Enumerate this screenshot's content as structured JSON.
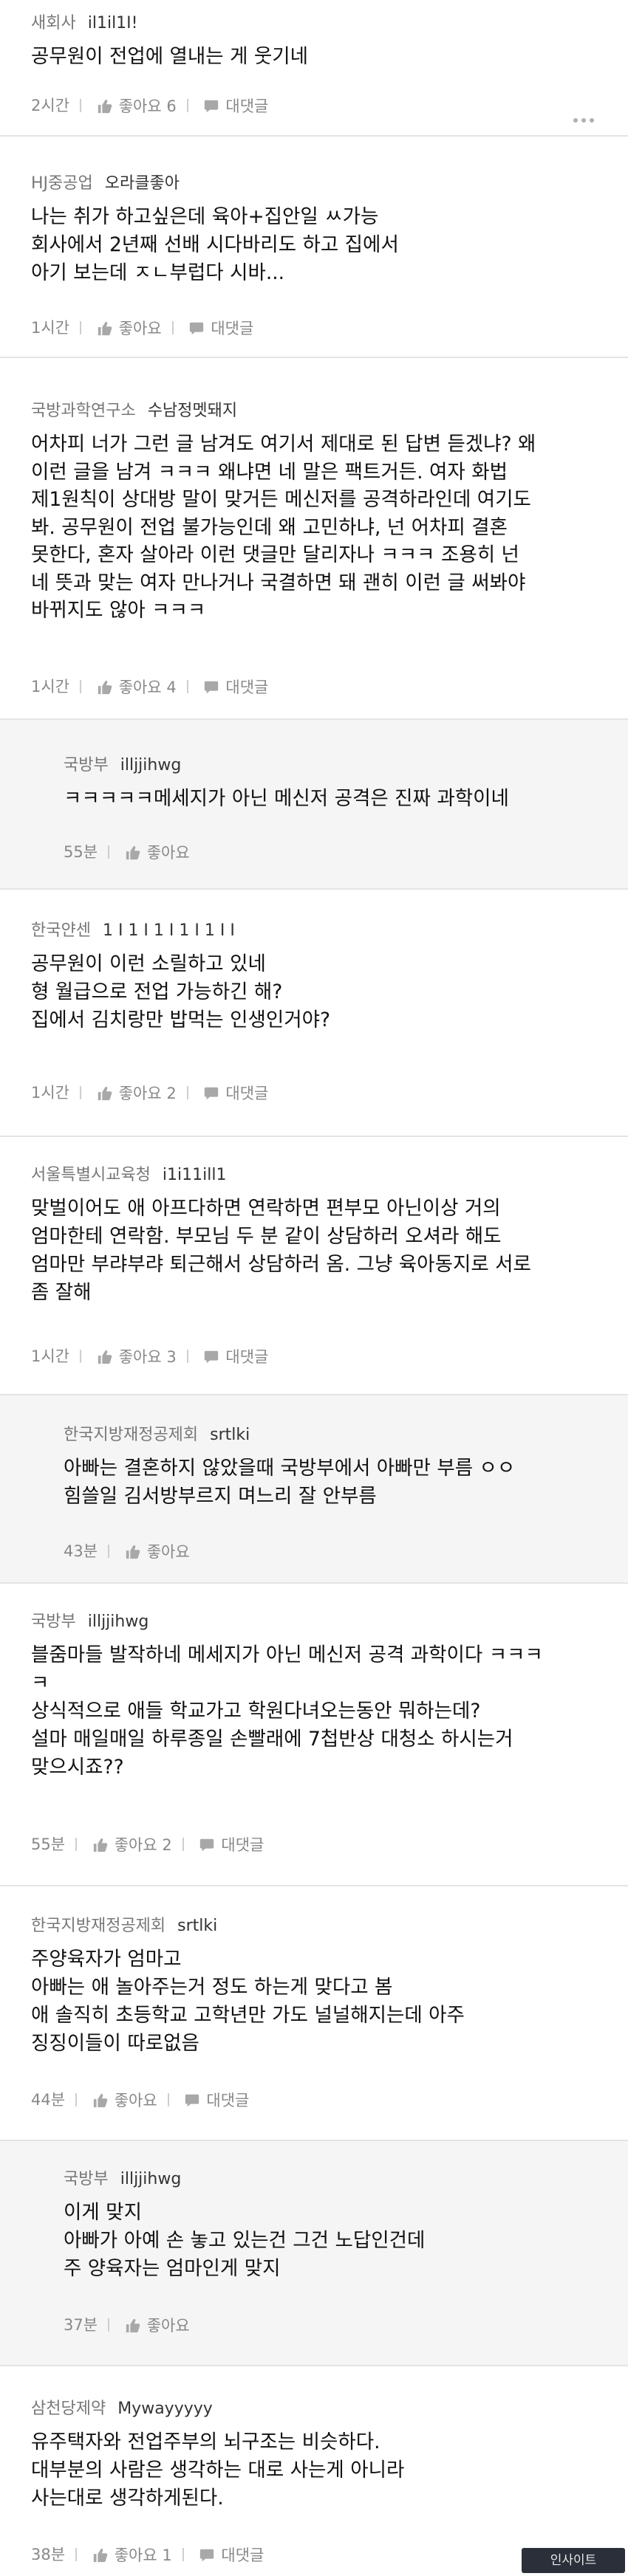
{
  "comments": [
    {
      "company": "새회사",
      "nick": "il1il1I!",
      "body": "공무원이 전업에 열내는 게 웃기네",
      "time": "2시간",
      "likes": "좋아요 6",
      "reply": "대댓글"
    },
    {
      "company": "HJ중공업",
      "nick": "오라클좋아",
      "body": "나는 취가 하고싶은데 육아+집안일 ㅆ가능\n회사에서 2년째 선배 시다바리도 하고 집에서\n아기 보는데 ㅈㄴ부럽다 시바...",
      "time": "1시간",
      "likes": "좋아요",
      "reply": "대댓글"
    },
    {
      "company": "국방과학연구소",
      "nick": "수남정멧돼지",
      "body": "어차피 너가 그런 글 남겨도 여기서 제대로 된 답변 듣겠냐? 왜\n이런 글을 남겨 ㅋㅋㅋ  왜냐면 네 말은 팩트거든. 여자 화법\n제1원칙이 상대방 말이 맞거든 메신저를 공격하라인데 여기도\n봐. 공무원이 전업 불가능인데 왜 고민하냐, 넌 어차피 결혼\n못한다, 혼자 살아라 이런 댓글만 달리자나 ㅋㅋㅋ 조용히 넌\n네 뜻과 맞는 여자 만나거나 국결하면 돼 괜히 이런 글 써봐야\n바뀌지도 않아 ㅋㅋㅋ",
      "time": "1시간",
      "likes": "좋아요 4",
      "reply": "대댓글"
    },
    {
      "company": "국방부",
      "nick": "illjjihwg",
      "body": "ㅋㅋㅋㅋㅋ메세지가 아닌 메신저 공격은 진짜 과학이네",
      "time": "55분",
      "likes": "좋아요",
      "reply": ""
    },
    {
      "company": "한국얀센",
      "nick": "1 I 1 I 1 I 1 I 1 I I",
      "body": "공무원이 이런 소릴하고 있네\n형 월급으로 전업 가능하긴 해?\n집에서 김치랑만 밥먹는 인생인거야?",
      "time": "1시간",
      "likes": "좋아요 2",
      "reply": "대댓글"
    },
    {
      "company": "서울특별시교육청",
      "nick": "i1i11ill1",
      "body": "맞벌이어도 애 아프다하면 연락하면 편부모 아닌이상 거의\n엄마한테 연락함. 부모님 두 분 같이 상담하러 오셔라 해도\n엄마만 부랴부랴 퇴근해서 상담하러 옴. 그냥 육아동지로 서로\n좀 잘해",
      "time": "1시간",
      "likes": "좋아요 3",
      "reply": "대댓글"
    },
    {
      "company": "한국지방재정공제회",
      "nick": "srtlki",
      "body": "아빠는 결혼하지 않았을때 국방부에서 아빠만 부름 ㅇㅇ\n힘쓸일 김서방부르지 며느리 잘 안부름",
      "time": "43분",
      "likes": "좋아요",
      "reply": ""
    },
    {
      "company": "국방부",
      "nick": "illjjihwg",
      "body": "블줌마들 발작하네 메세지가 아닌 메신저 공격 과학이다 ㅋㅋㅋ\nㅋ\n상식적으로 애들 학교가고 학원다녀오는동안 뭐하는데?\n설마 매일매일 하루종일 손빨래에 7첩반상 대청소 하시는거\n맞으시죠??",
      "time": "55분",
      "likes": "좋아요 2",
      "reply": "대댓글"
    },
    {
      "company": "한국지방재정공제회",
      "nick": "srtlki",
      "body": "주양육자가 엄마고\n아빠는 애 놀아주는거 정도 하는게 맞다고 봄\n애 솔직히 초등학교 고학년만 가도 널널해지는데 아주\n징징이들이 따로없음",
      "time": "44분",
      "likes": "좋아요",
      "reply": "대댓글"
    },
    {
      "company": "국방부",
      "nick": "illjjihwg",
      "body": "이게 맞지\n아빠가 아예 손 놓고 있는건 그건 노답인건데\n주 양육자는 엄마인게 맞지",
      "time": "37분",
      "likes": "좋아요",
      "reply": ""
    },
    {
      "company": "삼천당제약",
      "nick": "Mywayyyyy",
      "body": "유주택자와 전업주부의 뇌구조는 비슷하다.\n대부분의 사람은 생각하는 대로 사는게 아니라\n사는대로 생각하게된다.",
      "time": "38분",
      "likes": "좋아요 1",
      "reply": "대댓글"
    }
  ],
  "watermark": "인사이트",
  "icons": {
    "like": "thumbs-up-icon",
    "reply": "speech-bubble-icon",
    "more": "more-dots-icon"
  }
}
